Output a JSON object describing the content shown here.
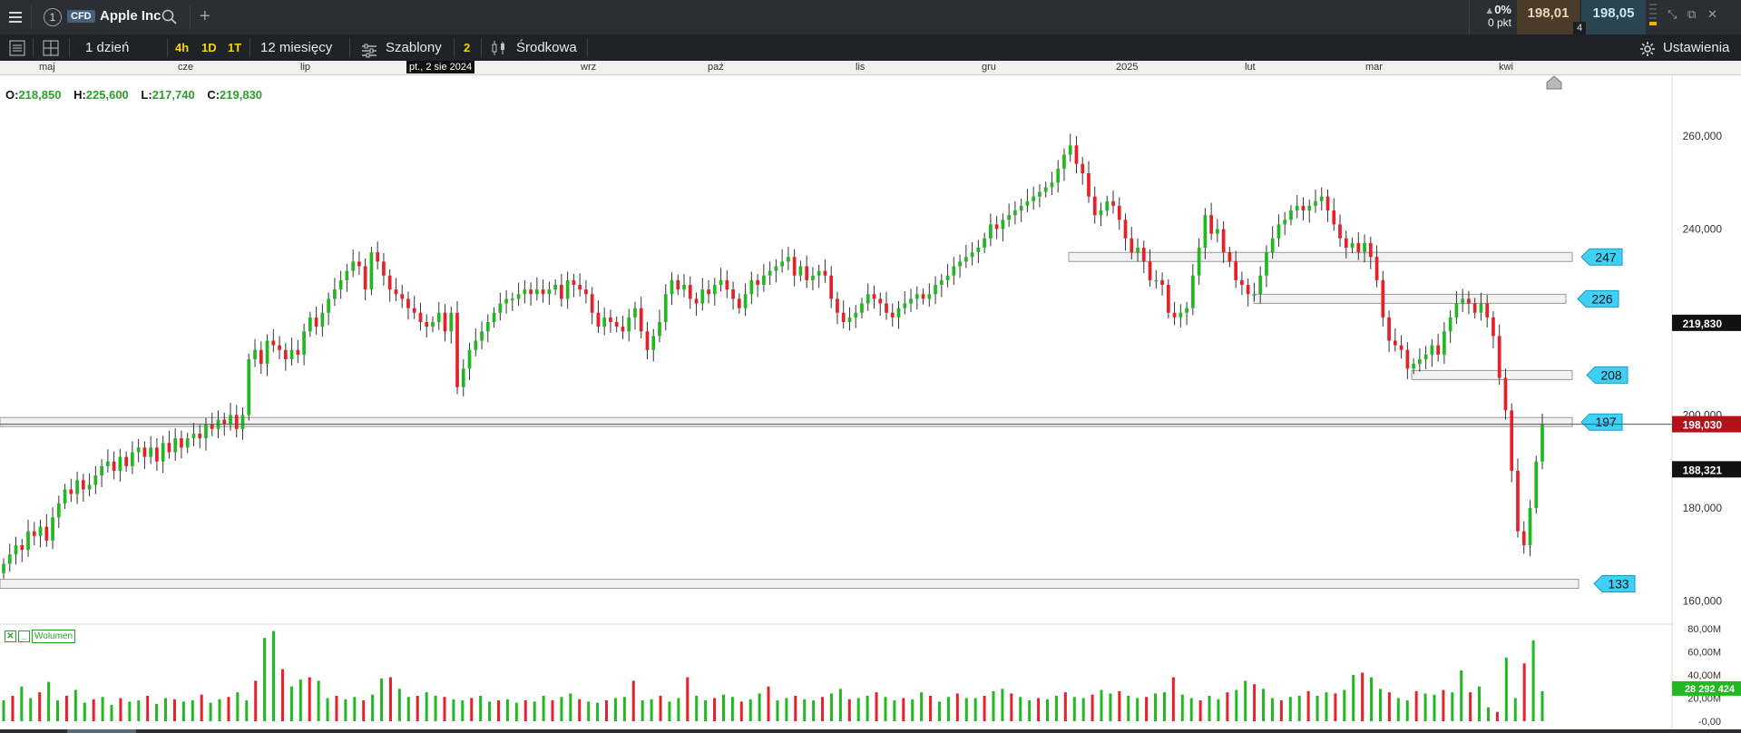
{
  "header": {
    "instance_number": "1",
    "type_badge": "CFD",
    "instrument_name": "Apple Inc",
    "change_percent": "0%",
    "change_points": "0 pkt",
    "bid": "198,01",
    "ask": "198,05",
    "spread_count": "4"
  },
  "toolbar": {
    "interval": "1 dzień",
    "quick_intervals": [
      "4h",
      "1D",
      "1T"
    ],
    "range": "12 miesięcy",
    "templates_label": "Szablony",
    "templates_count": "2",
    "price_mode": "Środkowa",
    "settings_label": "Ustawienia"
  },
  "time_axis": {
    "labels": [
      "maj",
      "cze",
      "lip",
      "wrz",
      "paź",
      "lis",
      "gru",
      "2025",
      "lut",
      "mar",
      "kwi"
    ],
    "hover_date": "pt., 2 sie 2024"
  },
  "ohlc": {
    "open_label": "O:",
    "open": "218,850",
    "high_label": "H:",
    "high": "225,600",
    "low_label": "L:",
    "low": "217,740",
    "close_label": "C:",
    "close": "219,830"
  },
  "price_axis": {
    "ticks": [
      "260,000",
      "240,000",
      "220,000",
      "200,000",
      "180,000",
      "160,000"
    ],
    "labels": [
      {
        "text": "219,830",
        "value": 219.83,
        "bg": "#111111"
      },
      {
        "text": "198,030",
        "value": 198.03,
        "bg": "#b3121a"
      },
      {
        "text": "188,321",
        "value": 188.32,
        "bg": "#111111"
      }
    ]
  },
  "levels": [
    {
      "label": "247",
      "value": 247
    },
    {
      "label": "226",
      "value": 226
    },
    {
      "label": "208",
      "value": 208
    },
    {
      "label": "197",
      "value": 197
    },
    {
      "label": "133",
      "value": 133
    }
  ],
  "volume": {
    "legend": "Wolumen",
    "ticks": [
      "80,00M",
      "60,00M",
      "40,00M",
      "20,00M",
      "-0,00"
    ],
    "current": "28 292 424"
  },
  "colors": {
    "up": "#22b822",
    "down": "#e8202a",
    "level_fill": "#eeeeee",
    "level_stroke": "#9a9a9a",
    "tag_fill": "#3fd0f5"
  },
  "chart_data": {
    "type": "candlestick",
    "ylim": [
      156,
      268
    ],
    "closes": [
      168,
      170,
      172,
      171,
      175,
      174,
      176,
      173,
      178,
      181,
      184,
      183,
      186,
      184,
      185,
      187,
      189,
      190,
      188,
      191,
      189,
      192,
      193,
      191,
      193,
      190,
      194,
      192,
      195,
      193,
      195,
      196,
      195,
      198,
      197,
      199,
      198,
      200,
      197,
      200,
      212,
      214,
      211,
      216,
      215,
      214,
      212,
      214,
      213,
      218,
      221,
      219,
      222,
      225,
      227,
      229,
      231,
      233,
      232,
      227,
      235,
      233,
      230,
      227,
      226,
      225,
      223,
      222,
      220,
      219,
      220,
      222,
      218,
      222,
      206,
      210,
      214,
      216,
      218,
      220,
      222,
      224,
      225,
      225,
      226,
      227,
      226,
      227,
      226,
      227,
      228,
      225,
      229,
      228,
      227,
      226,
      222,
      219,
      221,
      220,
      219,
      218,
      221,
      223,
      218,
      214,
      217,
      220,
      226,
      229,
      227,
      228,
      225,
      224,
      227,
      226,
      228,
      229,
      227,
      225,
      223,
      226,
      229,
      228,
      230,
      231,
      232,
      233,
      234,
      230,
      232,
      229,
      230,
      231,
      230,
      225,
      222,
      220,
      221,
      222,
      224,
      226,
      225,
      224,
      222,
      221,
      223,
      224,
      225,
      226,
      225,
      226,
      228,
      229,
      230,
      232,
      233,
      234,
      235,
      236,
      238,
      241,
      240,
      242,
      243,
      244,
      245,
      246,
      247,
      248,
      249,
      250,
      253,
      256,
      258,
      254,
      252,
      247,
      243,
      244,
      246,
      245,
      242,
      238,
      235,
      236,
      233,
      229,
      229,
      228,
      222,
      221,
      222,
      223,
      230,
      236,
      243,
      239,
      240,
      235,
      233,
      229,
      228,
      226,
      226,
      230,
      235,
      238,
      241,
      242,
      244,
      245,
      244,
      245,
      246,
      247,
      244,
      241,
      238,
      236,
      237,
      235,
      237,
      234,
      229,
      221,
      216,
      215,
      214,
      210,
      211,
      212,
      213,
      215,
      213,
      218,
      221,
      224,
      225,
      224,
      222,
      224,
      221,
      217,
      208,
      201,
      188,
      175,
      172,
      180,
      190,
      198
    ],
    "volumes": [
      18,
      22,
      30,
      20,
      25,
      34,
      18,
      22,
      27,
      16,
      19,
      21,
      14,
      20,
      17,
      18,
      22,
      15,
      20,
      19,
      17,
      18,
      23,
      16,
      19,
      21,
      25,
      18,
      35,
      72,
      78,
      45,
      30,
      36,
      38,
      35,
      20,
      22,
      19,
      21,
      18,
      23,
      37,
      38,
      28,
      21,
      22,
      25,
      22,
      21,
      19,
      18,
      20,
      22,
      17,
      18,
      19,
      16,
      18,
      17,
      22,
      18,
      21,
      24,
      19,
      17,
      16,
      18,
      20,
      21,
      35,
      18,
      19,
      22,
      17,
      20,
      38,
      22,
      18,
      20,
      23,
      21,
      17,
      19,
      24,
      30,
      18,
      20,
      22,
      19,
      18,
      21,
      24,
      28,
      19,
      20,
      22,
      25,
      21,
      18,
      20,
      19,
      25,
      22,
      17,
      21,
      24,
      20,
      20,
      22,
      26,
      28,
      24,
      21,
      18,
      20,
      19,
      22,
      25,
      21,
      20,
      23,
      27,
      24,
      26,
      22,
      20,
      21,
      24,
      25,
      38,
      23,
      20,
      18,
      22,
      19,
      25,
      27,
      35,
      32,
      28,
      20,
      18,
      21,
      22,
      26,
      22,
      25,
      24,
      27,
      40,
      42,
      38,
      28,
      25,
      20,
      18,
      26,
      24,
      23,
      27,
      25,
      44,
      25,
      30,
      12,
      8,
      55,
      20,
      50,
      70,
      26
    ]
  }
}
